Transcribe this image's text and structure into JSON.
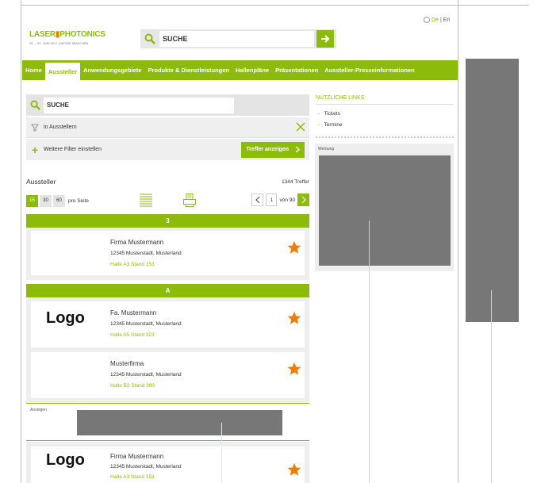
{
  "header": {
    "lang_de": "De",
    "lang_sep": "|",
    "lang_en": "En",
    "brand_left": "LASER",
    "brand_mid": "▮",
    "brand_right": "PHOTONICS",
    "brand_sub": "26. – 29. JUNI 2017 | MESSE MÜNCHEN",
    "search_value": "SUCHE"
  },
  "nav": [
    {
      "label": "Home"
    },
    {
      "label": "Aussteller"
    },
    {
      "label": "Anwendungsgebiete"
    },
    {
      "label": "Produkte & Dienstleistungen"
    },
    {
      "label": "Hallenpläne"
    },
    {
      "label": "Präsentationen"
    },
    {
      "label": "Aussteller-Presseinformationen"
    }
  ],
  "panel": {
    "search_value": "SUCHE",
    "filter_text": "in Ausstellern",
    "more_filters": "Weitere Filter einstellen",
    "show_results": "Treffer anzeigen"
  },
  "results": {
    "title": "Aussteller",
    "count": "1344 Treffer",
    "per_page": [
      "15",
      "30",
      "60"
    ],
    "per_page_label": "pro Seite",
    "current_page": "1",
    "total_pages": "von 90"
  },
  "groups": [
    {
      "letter": "3",
      "entries": [
        {
          "logo": "",
          "name": "Firma Mustermann",
          "address": "12345 Musterstadt, Musterland",
          "hall": "Halle A3 Stand 153"
        }
      ]
    },
    {
      "letter": "A",
      "entries": [
        {
          "logo": "Logo",
          "name": "Fa. Mustermann",
          "address": "12345 Musterstadt, Musterland",
          "hall": "Halle A5 Stand 323"
        },
        {
          "logo": "",
          "name": "Musterfirma",
          "address": "12345 Musterstadt, Musterland",
          "hall": "Halle B2 Stand 390"
        }
      ]
    }
  ],
  "ads_label": "Anzeigen",
  "bottom_entry": {
    "logo": "Logo",
    "name": "Firma Mustermann",
    "address": "12345 Musterstadt, Musterland",
    "hall": "Halle A3 Stand 153"
  },
  "sidebar": {
    "links_title": "NÜTZLICHE LINKS",
    "links": [
      "Tickets",
      "Termine"
    ],
    "werbung_label": "Werbung"
  },
  "colors": {
    "accent": "#8cbb0c",
    "star": "#f07d00",
    "ad_placeholder": "#777777"
  }
}
